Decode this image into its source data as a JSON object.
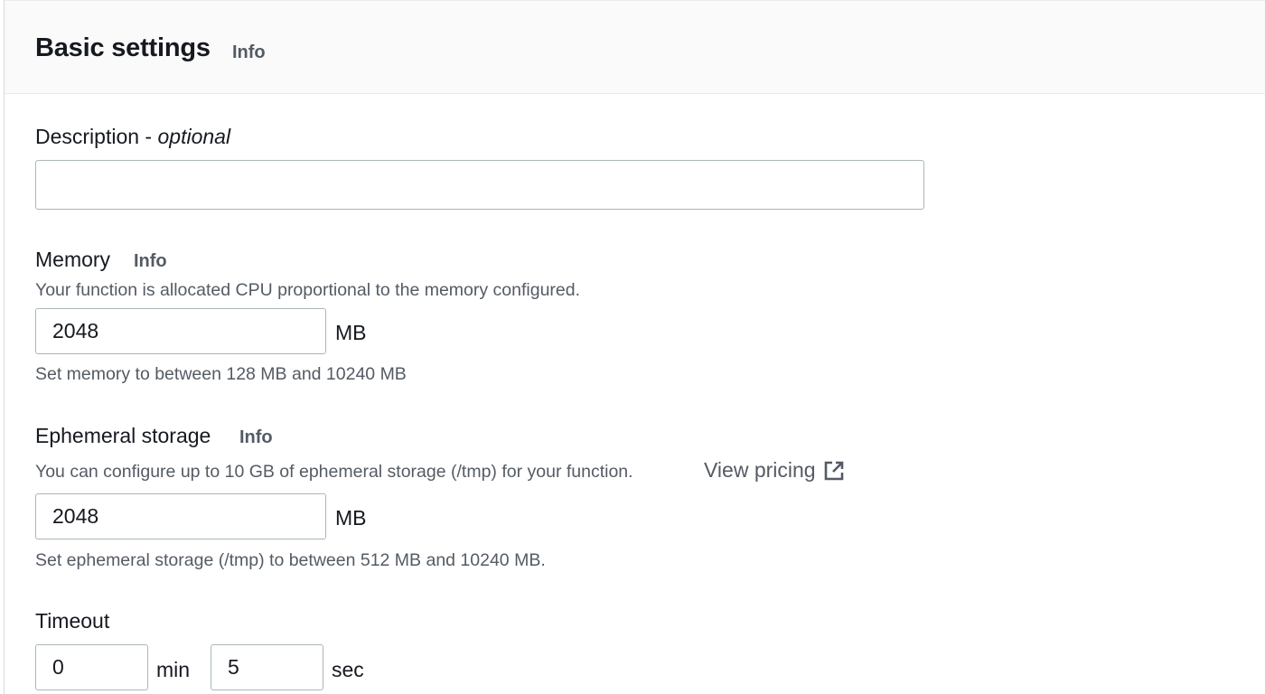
{
  "header": {
    "title": "Basic settings",
    "info": "Info"
  },
  "description": {
    "label": "Description - ",
    "label_optional": "optional",
    "value": ""
  },
  "memory": {
    "label": "Memory",
    "info": "Info",
    "description": "Your function is allocated CPU proportional to the memory configured.",
    "value": "2048",
    "unit": "MB",
    "constraint": "Set memory to between 128 MB and 10240 MB"
  },
  "ephemeral_storage": {
    "label": "Ephemeral storage",
    "info": "Info",
    "description": "You can configure up to 10 GB of ephemeral storage (/tmp) for your function.",
    "link_label": "View pricing",
    "link_icon": "external-link-icon",
    "value": "2048",
    "unit": "MB",
    "constraint": "Set ephemeral storage (/tmp) to between 512 MB and 10240 MB."
  },
  "timeout": {
    "label": "Timeout",
    "min_value": "0",
    "min_unit": "min",
    "sec_value": "5",
    "sec_unit": "sec"
  }
}
